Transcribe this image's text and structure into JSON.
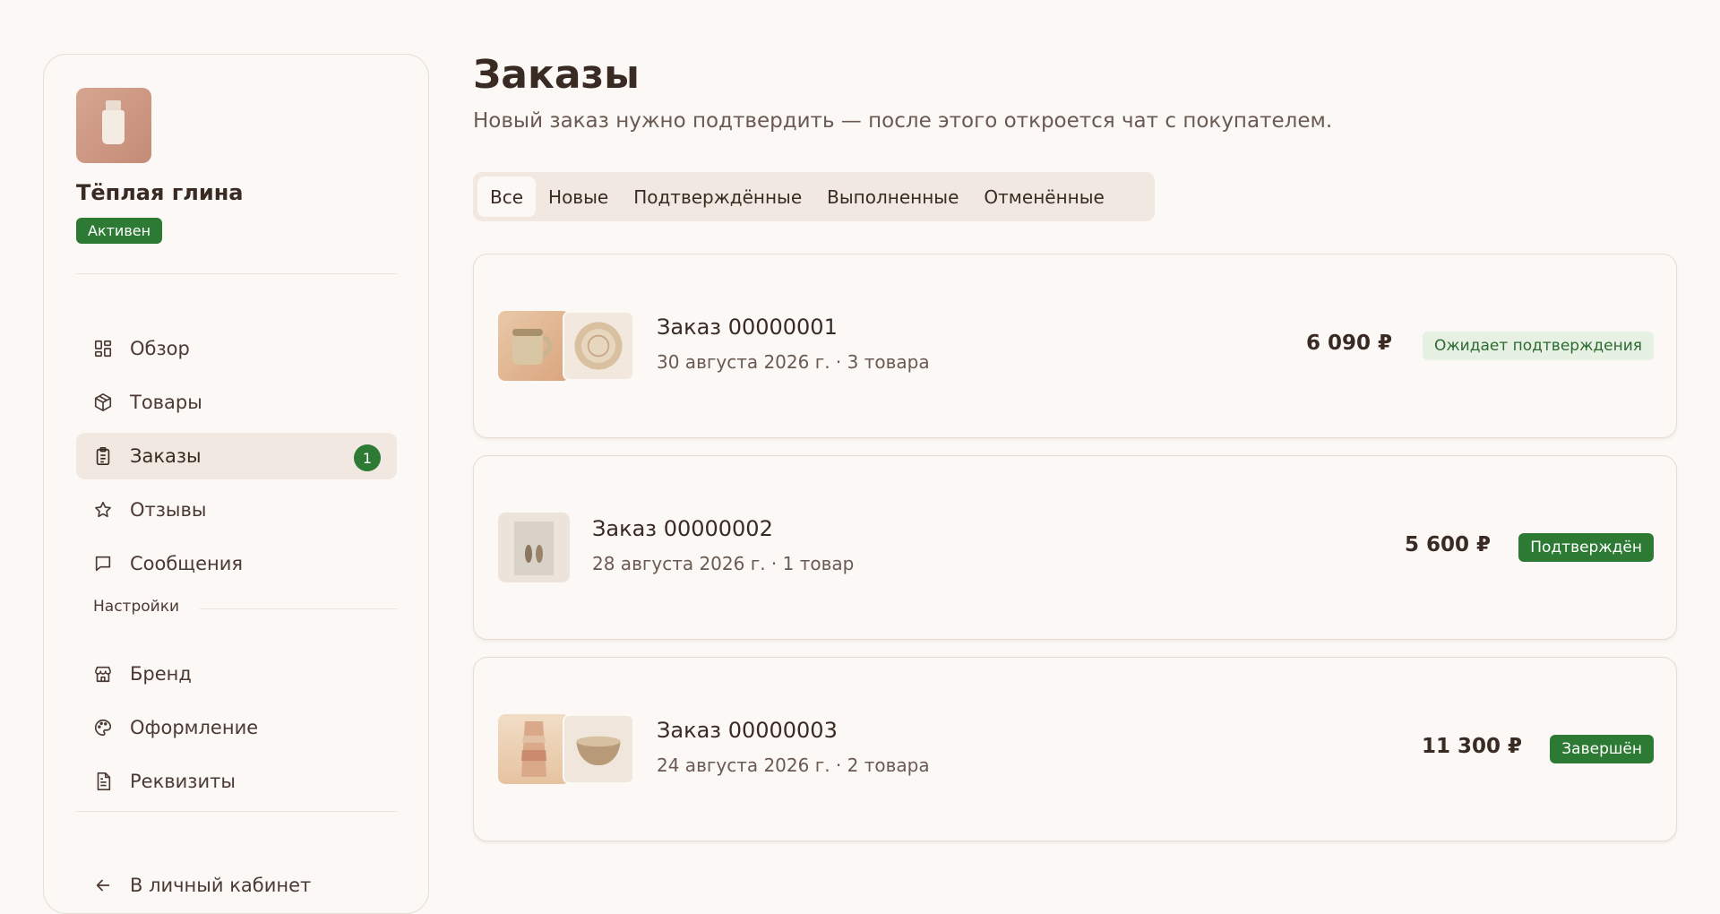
{
  "store": {
    "name": "Тёплая глина",
    "status": "Активен"
  },
  "nav": {
    "items": [
      {
        "label": "Обзор",
        "icon": "dashboard-icon"
      },
      {
        "label": "Товары",
        "icon": "box-icon"
      },
      {
        "label": "Заказы",
        "icon": "clipboard-icon",
        "badge": "1",
        "active": true
      },
      {
        "label": "Отзывы",
        "icon": "star-icon"
      },
      {
        "label": "Сообщения",
        "icon": "message-icon"
      }
    ],
    "settings_label": "Настройки",
    "settings_items": [
      {
        "label": "Бренд",
        "icon": "store-icon"
      },
      {
        "label": "Оформление",
        "icon": "palette-icon"
      },
      {
        "label": "Реквизиты",
        "icon": "document-icon"
      }
    ],
    "back_label": "В личный кабинет"
  },
  "page": {
    "title": "Заказы",
    "subtitle": "Новый заказ нужно подтвердить — после этого откроется чат с покупателем."
  },
  "tabs": [
    "Все",
    "Новые",
    "Подтверждённые",
    "Выполненные",
    "Отменённые"
  ],
  "active_tab": "Все",
  "orders": [
    {
      "title": "Заказ 00000001",
      "meta": "30 августа 2026 г. · 3 товара",
      "total": "6 090 ₽",
      "status": "Ожидает подтверждения"
    },
    {
      "title": "Заказ 00000002",
      "meta": "28 августа 2026 г. · 1 товар",
      "total": "5 600 ₽",
      "status": "Подтверждён"
    },
    {
      "title": "Заказ 00000003",
      "meta": "24 августа 2026 г. · 2 товара",
      "total": "11 300 ₽",
      "status": "Завершён"
    }
  ],
  "colors": {
    "background": "#fbf8f5",
    "accent_green": "#2d7a35",
    "pending_bg": "#e6f1e4",
    "active_nav_bg": "#f1e9e1",
    "text_dark": "#3a2a24"
  }
}
